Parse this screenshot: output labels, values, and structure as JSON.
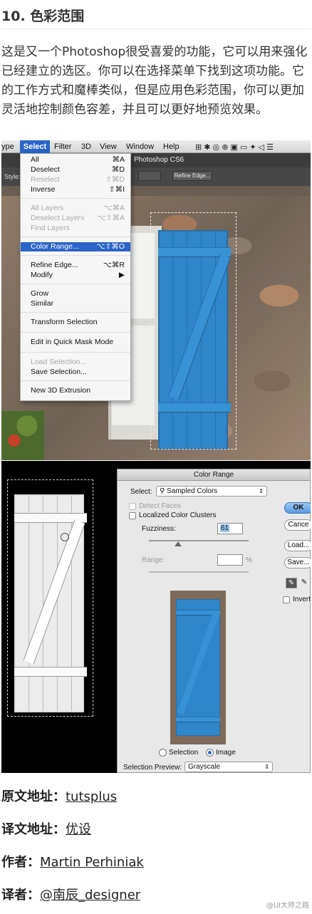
{
  "heading": "10. 色彩范围",
  "intro": "这是又一个Photoshop很受喜爱的功能，它可以用来强化已经建立的选区。你可以在选择菜单下找到这项功能。它的工作方式和魔棒类似，但是应用色彩范围，你可以更加灵活地控制颜色容差，并且可以更好地预览效果。",
  "menubar": {
    "items": [
      "ype",
      "Select",
      "Filter",
      "3D",
      "View",
      "Window",
      "Help"
    ],
    "app_title": "Photoshop CS6",
    "style_label": "Style:",
    "refine_button": "Refine Edge..."
  },
  "select_menu": [
    {
      "label": "All",
      "shortcut": "⌘A",
      "state": "normal"
    },
    {
      "label": "Deselect",
      "shortcut": "⌘D",
      "state": "normal"
    },
    {
      "label": "Reselect",
      "shortcut": "⇧⌘D",
      "state": "disabled"
    },
    {
      "label": "Inverse",
      "shortcut": "⇧⌘I",
      "state": "normal"
    },
    {
      "label": "All Layers",
      "shortcut": "⌥⌘A",
      "state": "disabled"
    },
    {
      "label": "Deselect Layers",
      "shortcut": "⌥⇧⌘A",
      "state": "disabled"
    },
    {
      "label": "Find Layers",
      "shortcut": "",
      "state": "disabled"
    },
    {
      "label": "Color Range...",
      "shortcut": "⌥⇧⌘O",
      "state": "highlighted"
    },
    {
      "label": "Refine Edge...",
      "shortcut": "⌥⌘R",
      "state": "normal"
    },
    {
      "label": "Modify",
      "shortcut": "▶",
      "state": "normal"
    },
    {
      "label": "Grow",
      "shortcut": "",
      "state": "normal"
    },
    {
      "label": "Similar",
      "shortcut": "",
      "state": "normal"
    },
    {
      "label": "Transform Selection",
      "shortcut": "",
      "state": "normal"
    },
    {
      "label": "Edit in Quick Mask Mode",
      "shortcut": "",
      "state": "normal"
    },
    {
      "label": "Load Selection...",
      "shortcut": "",
      "state": "disabled"
    },
    {
      "label": "Save Selection...",
      "shortcut": "",
      "state": "normal"
    },
    {
      "label": "New 3D Extrusion",
      "shortcut": "",
      "state": "normal"
    }
  ],
  "dialog": {
    "title": "Color Range",
    "select_label": "Select:",
    "select_value": "Sampled Colors",
    "detect_faces": "Detect Faces",
    "localized": "Localized Color Clusters",
    "fuzziness_label": "Fuzziness:",
    "fuzziness_value": "61",
    "range_label": "Range:",
    "range_unit": "%",
    "radio_selection": "Selection",
    "radio_image": "Image",
    "preview_label": "Selection Preview:",
    "preview_value": "Grayscale",
    "ok": "OK",
    "cancel": "Cance",
    "load": "Load...",
    "save": "Save...",
    "invert": "Invert"
  },
  "credits": [
    {
      "label": "原文地址：",
      "value": "tutsplus"
    },
    {
      "label": "译文地址：",
      "value": "优设"
    },
    {
      "label": "作者：",
      "value": "Martin Perhiniak"
    },
    {
      "label": "译者：",
      "value": "@南辰_designer"
    }
  ],
  "watermark": "@UI大师之路",
  "colors": {
    "shutter": "#2f86c9",
    "menu_highlight": "#2a64c8"
  }
}
